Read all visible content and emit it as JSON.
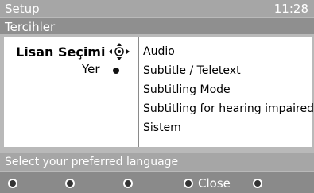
{
  "header": {
    "title": "Setup",
    "time": "11:28"
  },
  "subheader": {
    "title": "Tercihler"
  },
  "menu": {
    "left_items": [
      {
        "label": "Lisan Seçimi"
      },
      {
        "label": "Yer"
      }
    ],
    "options": [
      "Audio",
      "Subtitle / Teletext",
      "Subtitling Mode",
      "Subtitling for hearing impaired",
      "Sistem"
    ]
  },
  "hint": {
    "text": "Select your preferred language"
  },
  "footer": {
    "buttons": [
      {
        "label": ""
      },
      {
        "label": ""
      },
      {
        "label": ""
      },
      {
        "label": "Close"
      },
      {
        "label": ""
      }
    ]
  }
}
